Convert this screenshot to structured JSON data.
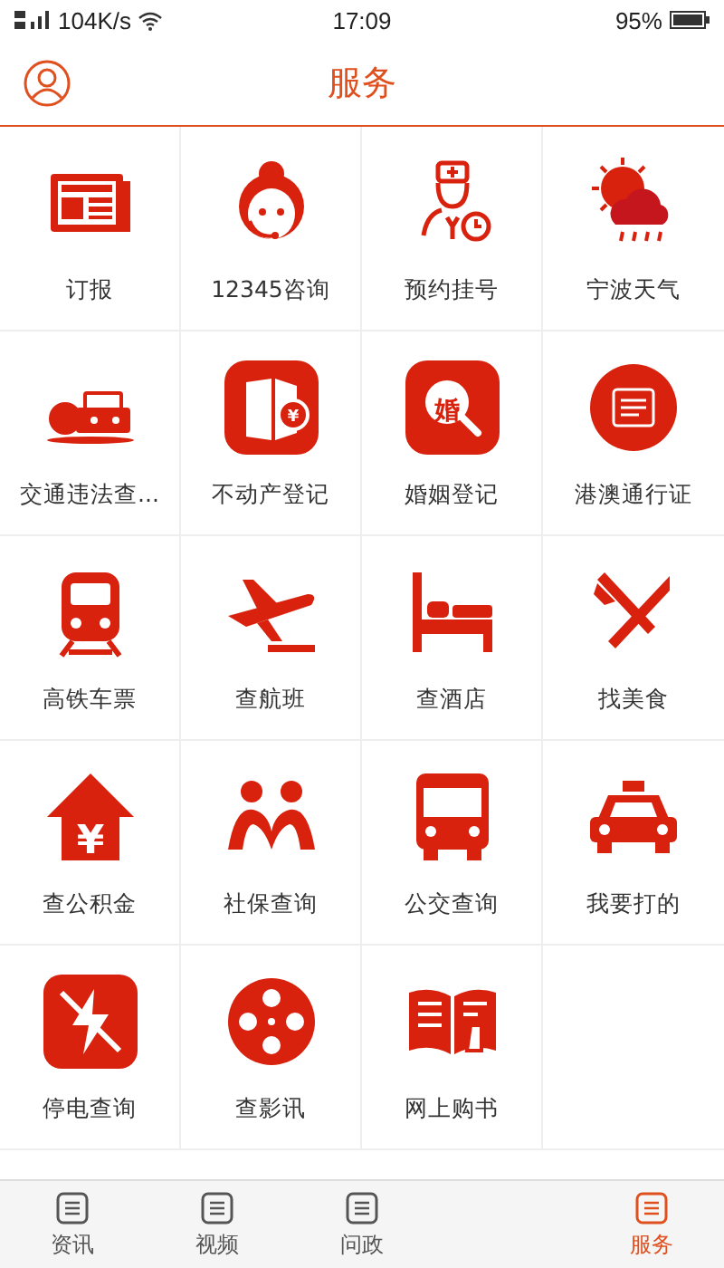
{
  "status_bar": {
    "speed": "104K/s",
    "time": "17:09",
    "battery": "95%"
  },
  "header": {
    "title": "服务"
  },
  "services": [
    {
      "label": "订报"
    },
    {
      "label": "12345咨询"
    },
    {
      "label": "预约挂号"
    },
    {
      "label": "宁波天气"
    },
    {
      "label": "交通违法查..."
    },
    {
      "label": "不动产登记",
      "icon_text": "¥"
    },
    {
      "label": "婚姻登记",
      "icon_text": "婚"
    },
    {
      "label": "港澳通行证"
    },
    {
      "label": "高铁车票"
    },
    {
      "label": "查航班"
    },
    {
      "label": "查酒店"
    },
    {
      "label": "找美食"
    },
    {
      "label": "查公积金",
      "icon_text": "¥"
    },
    {
      "label": "社保查询"
    },
    {
      "label": "公交查询"
    },
    {
      "label": "我要打的"
    },
    {
      "label": "停电查询"
    },
    {
      "label": "查影讯"
    },
    {
      "label": "网上购书"
    }
  ],
  "tab_bar": [
    {
      "label": "资讯",
      "selected": false
    },
    {
      "label": "视频",
      "selected": false
    },
    {
      "label": "问政",
      "selected": false
    },
    {
      "label": "服务",
      "selected": true
    }
  ]
}
